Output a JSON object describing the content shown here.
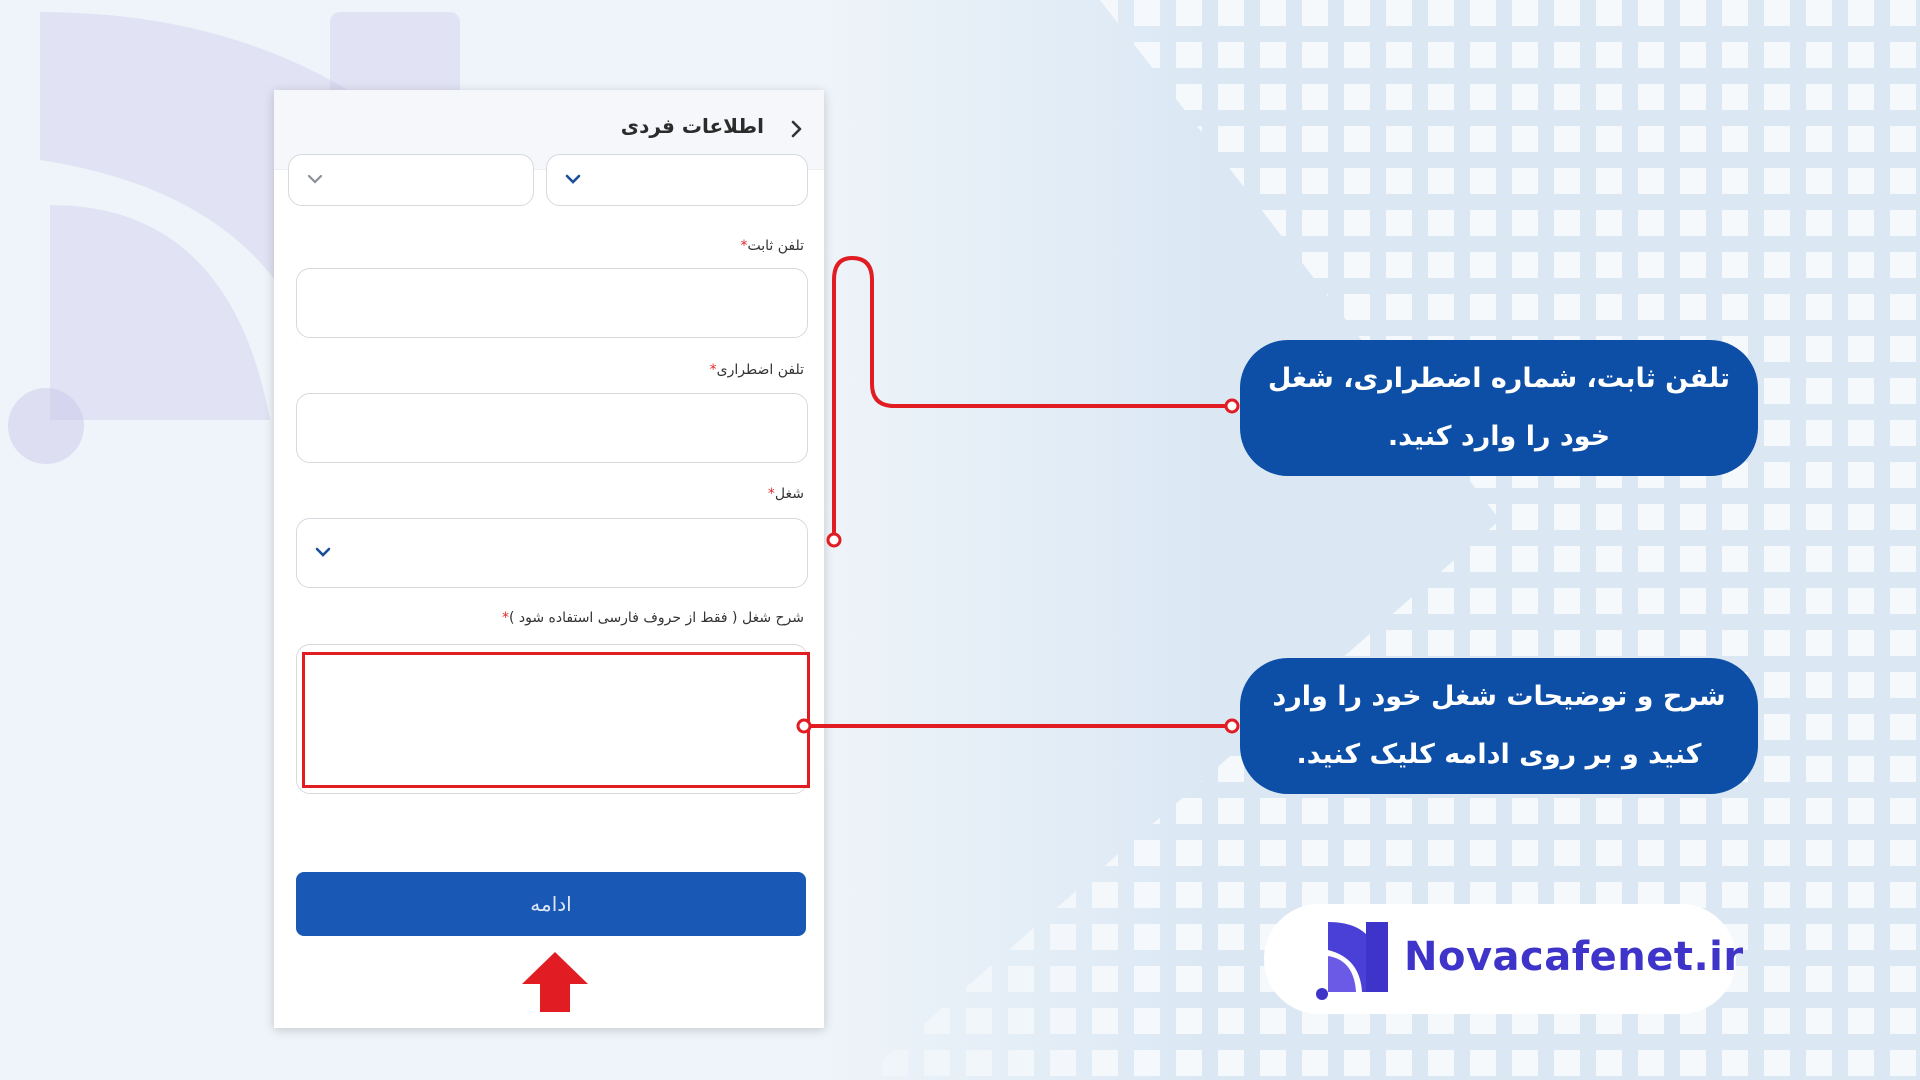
{
  "header": {
    "title": "اطلاعات فردی"
  },
  "form": {
    "landline_label": "تلفن ثابت",
    "emergency_label": "تلفن اضطراری",
    "job_label": "شغل",
    "job_description_label": "شرح شغل ( فقط از حروف فارسی استفاده شود )",
    "required_mark": "*"
  },
  "continue_button": {
    "label": "ادامه"
  },
  "callouts": [
    {
      "text": "تلفن ثابت، شماره اضطراری، شغل خود را وارد کنید."
    },
    {
      "text": "شرح و توضیحات شغل خود را وارد کنید و بر روی ادامه کلیک کنید."
    }
  ],
  "logo": {
    "text": "Novacafenet.ir"
  },
  "colors": {
    "accent_blue": "#1a58b6",
    "callout_blue": "#0d4ea6",
    "highlight_red": "#e11d23",
    "logo_purple": "#3f34c9"
  },
  "icons": [
    "back-chevron-icon",
    "chevron-down-icon",
    "red-up-arrow-icon",
    "novacafe-logo-icon"
  ]
}
